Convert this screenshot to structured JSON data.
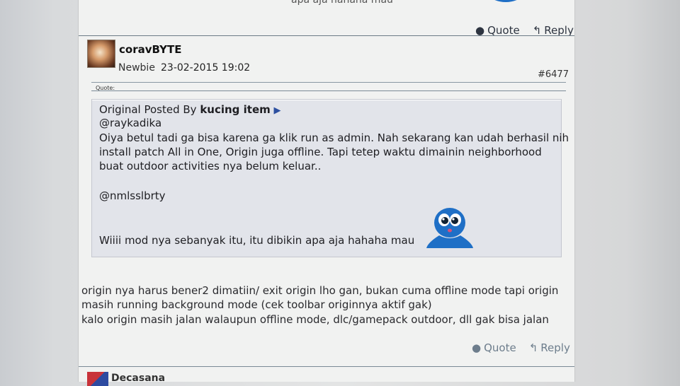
{
  "prev_post": {
    "text_fragment": "apa aja hahaha mau"
  },
  "actions": {
    "quote": "Quote",
    "reply": "Reply"
  },
  "post": {
    "username": "coravBYTE",
    "rank": "Newbie",
    "date": "23-02-2015 19:02",
    "number": "#6477",
    "quote": {
      "label": "Quote:",
      "prefix": "Original Posted By ",
      "author": "kucing item",
      "lines": [
        "@raykadika",
        "Oiya betul tadi ga bisa karena ga klik run as admin. Nah sekarang kan udah berhasil nih",
        "install patch All in One, Origin juga offline. Tapi tetep waktu dimainin neighborhood",
        "buat outdoor activities nya belum keluar..",
        "@nmlsslbrty",
        "Wiiii mod nya sebanyak itu, itu dibikin apa aja hahaha mau"
      ]
    },
    "body": [
      "origin nya harus bener2 dimatiin/ exit origin lho gan, bukan cuma offline mode tapi origin",
      "masih running background mode (cek toolbar originnya aktif gak)",
      "kalo origin masih jalan walaupun offline mode, dlc/gamepack outdoor, dll gak bisa jalan"
    ]
  },
  "next_post": {
    "username": "Decasana"
  },
  "colors": {
    "accent_link": "#2c4fa0",
    "mascot_blue": "#1f6fc6",
    "divider": "#6b7a86"
  }
}
